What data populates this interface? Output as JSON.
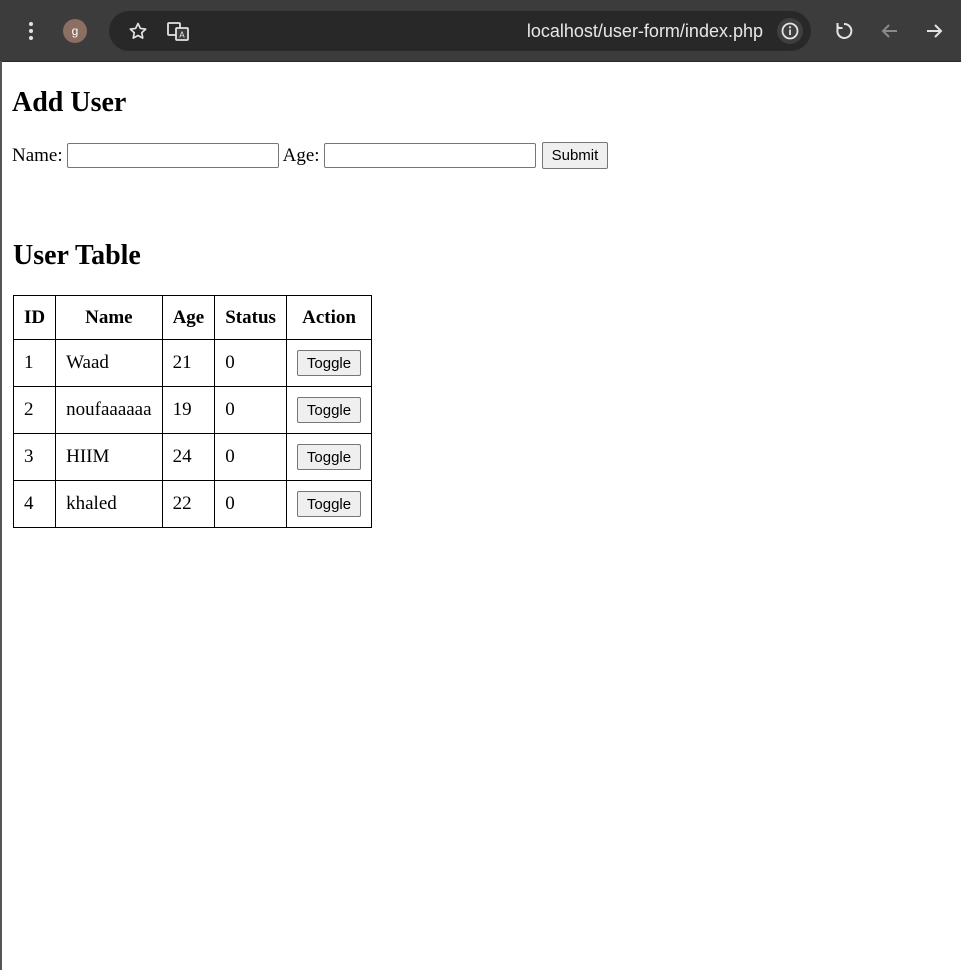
{
  "browser": {
    "profile_initial": "g",
    "url": "localhost/user-form/index.php",
    "icons": [
      "menu-dots-icon",
      "star-icon",
      "translate-icon",
      "site-info-icon",
      "reload-icon",
      "back-icon",
      "forward-icon"
    ]
  },
  "form": {
    "title": "Add User",
    "name_label": "Name:",
    "name_value": "",
    "age_label": "Age:",
    "age_value": "",
    "submit_label": "Submit"
  },
  "table": {
    "title": "User Table",
    "headers": [
      "ID",
      "Name",
      "Age",
      "Status",
      "Action"
    ],
    "rows": [
      {
        "id": "1",
        "name": "Waad",
        "age": "21",
        "status": "0",
        "action": "Toggle"
      },
      {
        "id": "2",
        "name": "noufaaaaaa",
        "age": "19",
        "status": "0",
        "action": "Toggle"
      },
      {
        "id": "3",
        "name": "HIIM",
        "age": "24",
        "status": "0",
        "action": "Toggle"
      },
      {
        "id": "4",
        "name": "khaled",
        "age": "22",
        "status": "0",
        "action": "Toggle"
      }
    ]
  }
}
